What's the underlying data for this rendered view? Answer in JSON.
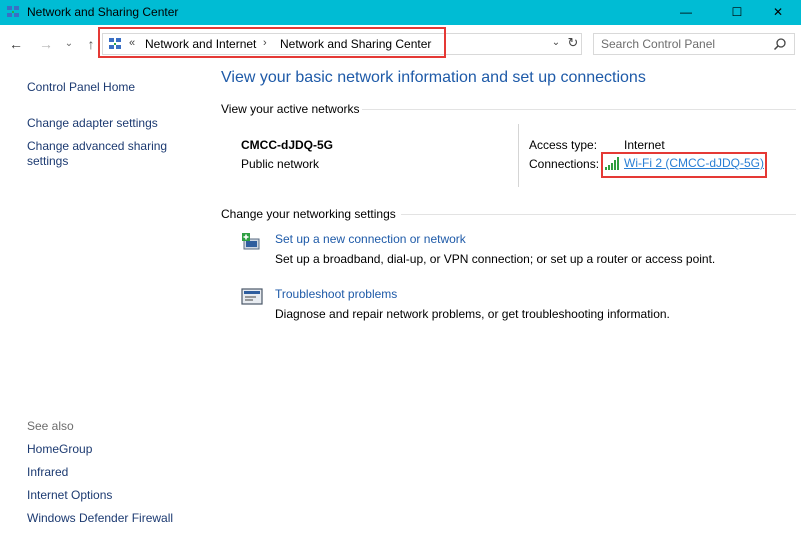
{
  "window": {
    "title": "Network and Sharing Center",
    "controls": {
      "minimize": "—",
      "maximize": "☐",
      "close": "✕"
    }
  },
  "nav": {
    "back": "←",
    "forward": "→",
    "recent": "⌄",
    "up": "↑"
  },
  "address": {
    "lead_sep": "«",
    "crumbs": [
      "Network and Internet",
      "Network and Sharing Center"
    ],
    "arrow": "›",
    "dropdown": "⌄",
    "refresh": "↻"
  },
  "search": {
    "placeholder": "Search Control Panel"
  },
  "left_pane": {
    "home": "Control Panel Home",
    "adapter": "Change adapter settings",
    "advanced": "Change advanced sharing settings",
    "see_also": "See also",
    "see_also_links": [
      "HomeGroup",
      "Infrared",
      "Internet Options",
      "Windows Defender Firewall"
    ]
  },
  "main": {
    "title": "View your basic network information and set up connections",
    "active_networks_heading": "View your active networks",
    "network": {
      "name": "CMCC-dJDQ-5G",
      "type": "Public network",
      "access_type_label": "Access type:",
      "access_type_value": "Internet",
      "connections_label": "Connections:",
      "connection_link": "Wi-Fi 2 (CMCC-dJDQ-5G)"
    },
    "change_settings_heading": "Change your networking settings",
    "tasks": [
      {
        "link": "Set up a new connection or network",
        "desc": "Set up a broadband, dial-up, or VPN connection; or set up a router or access point."
      },
      {
        "link": "Troubleshoot problems",
        "desc": "Diagnose and repair network problems, or get troubleshooting information."
      }
    ]
  },
  "colors": {
    "titlebar": "#00bcd4",
    "link": "#1e5aa8",
    "highlight": "#e53935"
  }
}
